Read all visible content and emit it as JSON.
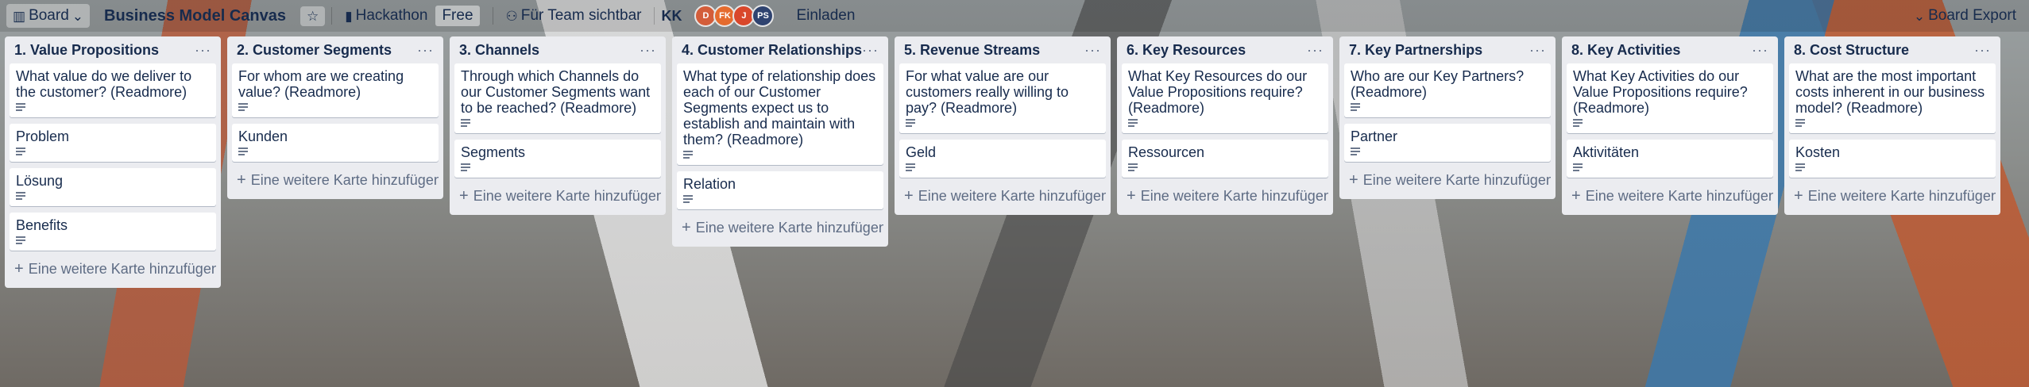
{
  "topbar": {
    "view_label": "Board",
    "board_title": "Business Model Canvas",
    "workspace_label": "Hackathon",
    "plan_badge": "Free",
    "visibility_label": "Für Team sichtbar",
    "workspace_initials": "KK",
    "avatars": [
      {
        "initials": "D",
        "color": "#d35d3a"
      },
      {
        "initials": "FK",
        "color": "#e56b2e"
      },
      {
        "initials": "J",
        "color": "#d9472b"
      },
      {
        "initials": "PS",
        "color": "#2f4370"
      }
    ],
    "invite_label": "Einladen",
    "export_label": "Board Export"
  },
  "lists": [
    {
      "title": "1. Value Propositions",
      "cards": [
        {
          "text": "What value do we deliver to the customer? (Readmore)"
        },
        {
          "text": "Problem"
        },
        {
          "text": "Lösung"
        },
        {
          "text": "Benefits"
        }
      ],
      "add_label": "Eine weitere Karte hinzufügen"
    },
    {
      "title": "2. Customer Segments",
      "cards": [
        {
          "text": "For whom are we creating value? (Readmore)"
        },
        {
          "text": "Kunden"
        }
      ],
      "add_label": "Eine weitere Karte hinzufügen"
    },
    {
      "title": "3. Channels",
      "cards": [
        {
          "text": "Through which Channels do our Customer Segments want to be reached? (Readmore)"
        },
        {
          "text": "Segments"
        }
      ],
      "add_label": "Eine weitere Karte hinzufügen"
    },
    {
      "title": "4. Customer Relationships",
      "cards": [
        {
          "text": "What type of relationship does each of our Customer Segments expect us to establish and maintain with them? (Readmore)"
        },
        {
          "text": "Relation"
        }
      ],
      "add_label": "Eine weitere Karte hinzufügen"
    },
    {
      "title": "5. Revenue Streams",
      "cards": [
        {
          "text": "For what value are our customers really willing to pay? (Readmore)"
        },
        {
          "text": "Geld"
        }
      ],
      "add_label": "Eine weitere Karte hinzufügen"
    },
    {
      "title": "6. Key Resources",
      "cards": [
        {
          "text": "What Key Resources do our Value Propositions require? (Readmore)"
        },
        {
          "text": "Ressourcen"
        }
      ],
      "add_label": "Eine weitere Karte hinzufügen"
    },
    {
      "title": "7. Key Partnerships",
      "cards": [
        {
          "text": "Who are our Key Partners? (Readmore)"
        },
        {
          "text": "Partner"
        }
      ],
      "add_label": "Eine weitere Karte hinzufügen"
    },
    {
      "title": "8. Key Activities",
      "cards": [
        {
          "text": "What Key Activities do our Value Propositions require? (Readmore)"
        },
        {
          "text": "Aktivitäten"
        }
      ],
      "add_label": "Eine weitere Karte hinzufügen"
    },
    {
      "title": "8. Cost Structure",
      "cards": [
        {
          "text": "What are the most important costs inherent in our business model? (Readmore)"
        },
        {
          "text": "Kosten"
        }
      ],
      "add_label": "Eine weitere Karte hinzufügen"
    }
  ]
}
